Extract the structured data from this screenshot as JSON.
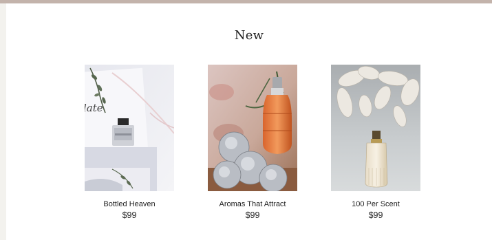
{
  "section": {
    "title": "New"
  },
  "products": [
    {
      "name": "Bottled Heaven",
      "price": "$99",
      "image": "perfume-with-invitation-card-photo"
    },
    {
      "name": "Aromas That Attract",
      "price": "$99",
      "image": "amber-perfume-with-silver-flowers-photo"
    },
    {
      "name": "100 Per Scent",
      "price": "$99",
      "image": "clear-perfume-with-white-petals-photo"
    }
  ],
  "colors": {
    "top_band": "#c3b3ab",
    "page_bg": "#f3f2ee",
    "panel_bg": "#ffffff"
  }
}
